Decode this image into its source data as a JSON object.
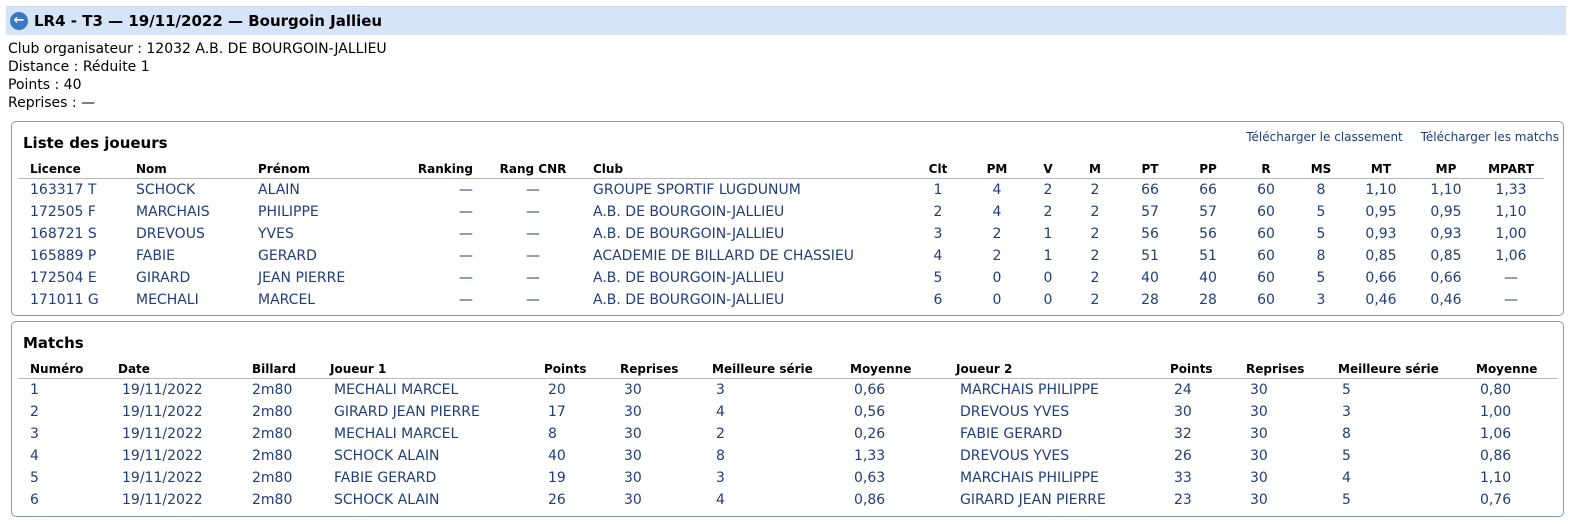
{
  "header": {
    "title": "LR4 - T3 — 19/11/2022 — Bourgoin Jallieu",
    "back_icon": "←"
  },
  "info": {
    "club": "Club organisateur : 12032 A.B. DE BOURGOIN-JALLIEU",
    "distance": "Distance : Réduite 1",
    "points": "Points : 40",
    "reprises": "Reprises : —"
  },
  "players": {
    "title": "Liste des joueurs",
    "download_ranking": "Télécharger le classement",
    "download_matches": "Télécharger les matchs",
    "columns": [
      "Licence",
      "Nom",
      "Prénom",
      "Ranking",
      "Rang CNR",
      "Club",
      "Clt",
      "PM",
      "V",
      "M",
      "PT",
      "PP",
      "R",
      "MS",
      "MT",
      "MP",
      "MPART"
    ],
    "rows": [
      [
        "163317 T",
        "SCHOCK",
        "ALAIN",
        "—",
        "—",
        "GROUPE SPORTIF LUGDUNUM",
        "1",
        "4",
        "2",
        "2",
        "66",
        "66",
        "60",
        "8",
        "1,10",
        "1,10",
        "1,33"
      ],
      [
        "172505 F",
        "MARCHAIS",
        "PHILIPPE",
        "—",
        "—",
        "A.B. DE BOURGOIN-JALLIEU",
        "2",
        "4",
        "2",
        "2",
        "57",
        "57",
        "60",
        "5",
        "0,95",
        "0,95",
        "1,10"
      ],
      [
        "168721 S",
        "DREVOUS",
        "YVES",
        "—",
        "—",
        "A.B. DE BOURGOIN-JALLIEU",
        "3",
        "2",
        "1",
        "2",
        "56",
        "56",
        "60",
        "5",
        "0,93",
        "0,93",
        "1,00"
      ],
      [
        "165889 P",
        "FABIE",
        "GERARD",
        "—",
        "—",
        "ACADEMIE DE BILLARD DE CHASSIEU",
        "4",
        "2",
        "1",
        "2",
        "51",
        "51",
        "60",
        "8",
        "0,85",
        "0,85",
        "1,06"
      ],
      [
        "172504 E",
        "GIRARD",
        "JEAN PIERRE",
        "—",
        "—",
        "A.B. DE BOURGOIN-JALLIEU",
        "5",
        "0",
        "0",
        "2",
        "40",
        "40",
        "60",
        "5",
        "0,66",
        "0,66",
        "—"
      ],
      [
        "171011 G",
        "MECHALI",
        "MARCEL",
        "—",
        "—",
        "A.B. DE BOURGOIN-JALLIEU",
        "6",
        "0",
        "0",
        "2",
        "28",
        "28",
        "60",
        "3",
        "0,46",
        "0,46",
        "—"
      ]
    ]
  },
  "matches": {
    "title": "Matchs",
    "columns": [
      "Numéro",
      "Date",
      "Billard",
      "Joueur 1",
      "Points",
      "Reprises",
      "Meilleure série",
      "Moyenne",
      "Joueur 2",
      "Points",
      "Reprises",
      "Meilleure série",
      "Moyenne"
    ],
    "rows": [
      [
        "1",
        "19/11/2022",
        "2m80",
        "MECHALI MARCEL",
        "20",
        "30",
        "3",
        "0,66",
        "MARCHAIS PHILIPPE",
        "24",
        "30",
        "5",
        "0,80"
      ],
      [
        "2",
        "19/11/2022",
        "2m80",
        "GIRARD JEAN PIERRE",
        "17",
        "30",
        "4",
        "0,56",
        "DREVOUS YVES",
        "30",
        "30",
        "3",
        "1,00"
      ],
      [
        "3",
        "19/11/2022",
        "2m80",
        "MECHALI MARCEL",
        "8",
        "30",
        "2",
        "0,26",
        "FABIE GERARD",
        "32",
        "30",
        "8",
        "1,06"
      ],
      [
        "4",
        "19/11/2022",
        "2m80",
        "SCHOCK ALAIN",
        "40",
        "30",
        "8",
        "1,33",
        "DREVOUS YVES",
        "26",
        "30",
        "5",
        "0,86"
      ],
      [
        "5",
        "19/11/2022",
        "2m80",
        "FABIE GERARD",
        "19",
        "30",
        "3",
        "0,63",
        "MARCHAIS PHILIPPE",
        "33",
        "30",
        "4",
        "1,10"
      ],
      [
        "6",
        "19/11/2022",
        "2m80",
        "SCHOCK ALAIN",
        "26",
        "30",
        "4",
        "0,86",
        "GIRARD JEAN PIERRE",
        "23",
        "30",
        "5",
        "0,76"
      ]
    ]
  }
}
